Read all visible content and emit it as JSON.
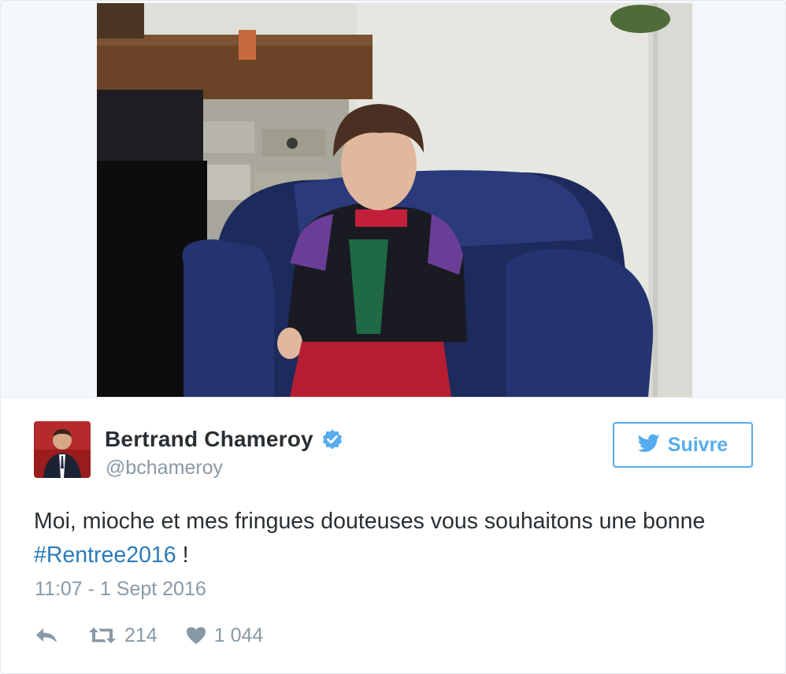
{
  "tweet": {
    "author": {
      "display_name": "Bertrand Chameroy",
      "handle": "@bchameroy",
      "verified": true
    },
    "follow_button": {
      "label": "Suivre",
      "icon": "twitter-bird-icon",
      "color": "#55acee"
    },
    "text": {
      "before": "Moi, mioche et mes fringues douteuses vous souhaitons une bonne ",
      "hashtag": "#Rentree2016",
      "after": " !"
    },
    "timestamp": "11:07 - 1 Sept 2016",
    "actions": {
      "reply_icon": "reply-icon",
      "retweet_icon": "retweet-icon",
      "retweet_count": "214",
      "like_icon": "heart-icon",
      "like_count": "1 044"
    },
    "colors": {
      "text": "#292f33",
      "muted": "#8899a6",
      "link": "#2b7bb9",
      "verified": "#55acee"
    }
  }
}
